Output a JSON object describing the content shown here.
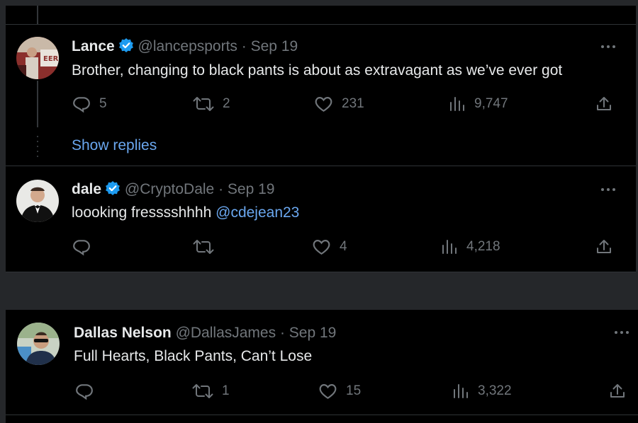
{
  "colors": {
    "background": "#000000",
    "gutter": "#25272a",
    "text": "#e7e9ea",
    "muted": "#71767b",
    "link": "#6aa7ef",
    "verified": "#1d9bf0"
  },
  "tweets": [
    {
      "name": "Lance",
      "handle": "@lancepsports",
      "separator": "·",
      "date": "Sep 19",
      "text": "Brother, changing to black pants is about as extravagant as we’ve ever got",
      "mention": "",
      "replies": "5",
      "retweets": "2",
      "likes": "231",
      "views": "9,747"
    },
    {
      "name": "dale",
      "handle": "@CryptoDale",
      "separator": "·",
      "date": "Sep 19",
      "text": "loooking fresssshhhh ",
      "mention": "@cdejean23",
      "replies": "",
      "retweets": "",
      "likes": "4",
      "views": "4,218"
    },
    {
      "name": "Dallas Nelson",
      "handle": "@DallasJames",
      "separator": "·",
      "date": "Sep 19",
      "text": "Full Hearts, Black Pants, Can’t Lose",
      "mention": "",
      "replies": "",
      "retweets": "1",
      "likes": "15",
      "views": "3,322"
    }
  ],
  "show_replies": "Show replies",
  "icons": {
    "reply": "reply-icon",
    "retweet": "retweet-icon",
    "like": "heart-icon",
    "views": "views-chart-icon",
    "share": "share-icon",
    "more": "more-dots-icon",
    "verified": "verified-badge-icon"
  }
}
